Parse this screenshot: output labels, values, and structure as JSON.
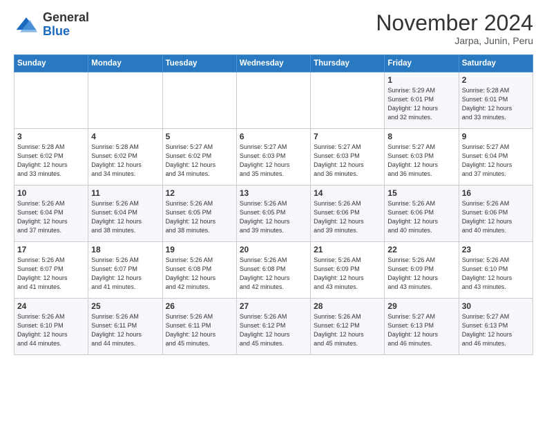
{
  "header": {
    "logo_general": "General",
    "logo_blue": "Blue",
    "month_title": "November 2024",
    "subtitle": "Jarpa, Junin, Peru"
  },
  "weekdays": [
    "Sunday",
    "Monday",
    "Tuesday",
    "Wednesday",
    "Thursday",
    "Friday",
    "Saturday"
  ],
  "weeks": [
    [
      {
        "day": "",
        "info": ""
      },
      {
        "day": "",
        "info": ""
      },
      {
        "day": "",
        "info": ""
      },
      {
        "day": "",
        "info": ""
      },
      {
        "day": "",
        "info": ""
      },
      {
        "day": "1",
        "info": "Sunrise: 5:29 AM\nSunset: 6:01 PM\nDaylight: 12 hours\nand 32 minutes."
      },
      {
        "day": "2",
        "info": "Sunrise: 5:28 AM\nSunset: 6:01 PM\nDaylight: 12 hours\nand 33 minutes."
      }
    ],
    [
      {
        "day": "3",
        "info": "Sunrise: 5:28 AM\nSunset: 6:02 PM\nDaylight: 12 hours\nand 33 minutes."
      },
      {
        "day": "4",
        "info": "Sunrise: 5:28 AM\nSunset: 6:02 PM\nDaylight: 12 hours\nand 34 minutes."
      },
      {
        "day": "5",
        "info": "Sunrise: 5:27 AM\nSunset: 6:02 PM\nDaylight: 12 hours\nand 34 minutes."
      },
      {
        "day": "6",
        "info": "Sunrise: 5:27 AM\nSunset: 6:03 PM\nDaylight: 12 hours\nand 35 minutes."
      },
      {
        "day": "7",
        "info": "Sunrise: 5:27 AM\nSunset: 6:03 PM\nDaylight: 12 hours\nand 36 minutes."
      },
      {
        "day": "8",
        "info": "Sunrise: 5:27 AM\nSunset: 6:03 PM\nDaylight: 12 hours\nand 36 minutes."
      },
      {
        "day": "9",
        "info": "Sunrise: 5:27 AM\nSunset: 6:04 PM\nDaylight: 12 hours\nand 37 minutes."
      }
    ],
    [
      {
        "day": "10",
        "info": "Sunrise: 5:26 AM\nSunset: 6:04 PM\nDaylight: 12 hours\nand 37 minutes."
      },
      {
        "day": "11",
        "info": "Sunrise: 5:26 AM\nSunset: 6:04 PM\nDaylight: 12 hours\nand 38 minutes."
      },
      {
        "day": "12",
        "info": "Sunrise: 5:26 AM\nSunset: 6:05 PM\nDaylight: 12 hours\nand 38 minutes."
      },
      {
        "day": "13",
        "info": "Sunrise: 5:26 AM\nSunset: 6:05 PM\nDaylight: 12 hours\nand 39 minutes."
      },
      {
        "day": "14",
        "info": "Sunrise: 5:26 AM\nSunset: 6:06 PM\nDaylight: 12 hours\nand 39 minutes."
      },
      {
        "day": "15",
        "info": "Sunrise: 5:26 AM\nSunset: 6:06 PM\nDaylight: 12 hours\nand 40 minutes."
      },
      {
        "day": "16",
        "info": "Sunrise: 5:26 AM\nSunset: 6:06 PM\nDaylight: 12 hours\nand 40 minutes."
      }
    ],
    [
      {
        "day": "17",
        "info": "Sunrise: 5:26 AM\nSunset: 6:07 PM\nDaylight: 12 hours\nand 41 minutes."
      },
      {
        "day": "18",
        "info": "Sunrise: 5:26 AM\nSunset: 6:07 PM\nDaylight: 12 hours\nand 41 minutes."
      },
      {
        "day": "19",
        "info": "Sunrise: 5:26 AM\nSunset: 6:08 PM\nDaylight: 12 hours\nand 42 minutes."
      },
      {
        "day": "20",
        "info": "Sunrise: 5:26 AM\nSunset: 6:08 PM\nDaylight: 12 hours\nand 42 minutes."
      },
      {
        "day": "21",
        "info": "Sunrise: 5:26 AM\nSunset: 6:09 PM\nDaylight: 12 hours\nand 43 minutes."
      },
      {
        "day": "22",
        "info": "Sunrise: 5:26 AM\nSunset: 6:09 PM\nDaylight: 12 hours\nand 43 minutes."
      },
      {
        "day": "23",
        "info": "Sunrise: 5:26 AM\nSunset: 6:10 PM\nDaylight: 12 hours\nand 43 minutes."
      }
    ],
    [
      {
        "day": "24",
        "info": "Sunrise: 5:26 AM\nSunset: 6:10 PM\nDaylight: 12 hours\nand 44 minutes."
      },
      {
        "day": "25",
        "info": "Sunrise: 5:26 AM\nSunset: 6:11 PM\nDaylight: 12 hours\nand 44 minutes."
      },
      {
        "day": "26",
        "info": "Sunrise: 5:26 AM\nSunset: 6:11 PM\nDaylight: 12 hours\nand 45 minutes."
      },
      {
        "day": "27",
        "info": "Sunrise: 5:26 AM\nSunset: 6:12 PM\nDaylight: 12 hours\nand 45 minutes."
      },
      {
        "day": "28",
        "info": "Sunrise: 5:26 AM\nSunset: 6:12 PM\nDaylight: 12 hours\nand 45 minutes."
      },
      {
        "day": "29",
        "info": "Sunrise: 5:27 AM\nSunset: 6:13 PM\nDaylight: 12 hours\nand 46 minutes."
      },
      {
        "day": "30",
        "info": "Sunrise: 5:27 AM\nSunset: 6:13 PM\nDaylight: 12 hours\nand 46 minutes."
      }
    ]
  ]
}
